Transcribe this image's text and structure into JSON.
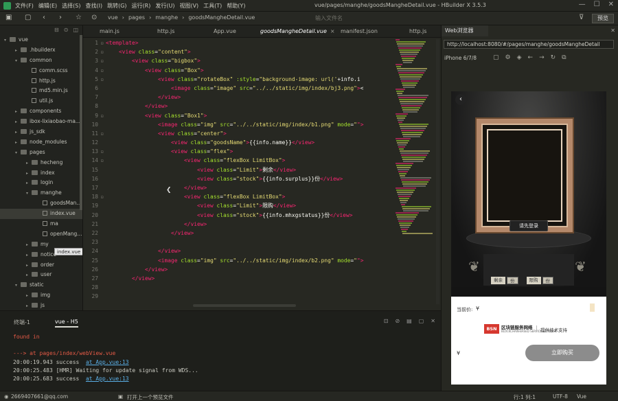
{
  "titlebar": {
    "menus": [
      "文件(F)",
      "编辑(E)",
      "选择(S)",
      "查找(I)",
      "跳转(G)",
      "运行(R)",
      "发行(U)",
      "视图(V)",
      "工具(T)",
      "帮助(Y)"
    ],
    "title": "vue/pages/manghe/goodsMangheDetail.vue - HBuilder X 3.5.3"
  },
  "toolbar": {
    "breadcrumb": [
      "vue",
      "pages",
      "manghe",
      "goodsMangheDetail.vue"
    ],
    "search_placeholder": "输入文件名",
    "run_label": "预览"
  },
  "sidebar": {
    "tree": [
      {
        "label": "vue",
        "type": "folder",
        "depth": 0,
        "open": true
      },
      {
        "label": ".hbuilderx",
        "type": "folder",
        "depth": 1,
        "open": false
      },
      {
        "label": "common",
        "type": "folder",
        "depth": 1,
        "open": true
      },
      {
        "label": "comm.scss",
        "type": "file",
        "depth": 2
      },
      {
        "label": "http.js",
        "type": "file",
        "depth": 2
      },
      {
        "label": "md5.min.js",
        "type": "file",
        "depth": 2
      },
      {
        "label": "util.js",
        "type": "file",
        "depth": 2
      },
      {
        "label": "components",
        "type": "folder",
        "depth": 1,
        "open": false
      },
      {
        "label": "ibox-lixiaobao-ma...",
        "type": "folder",
        "depth": 1,
        "open": false
      },
      {
        "label": "js_sdk",
        "type": "folder",
        "depth": 1,
        "open": false
      },
      {
        "label": "node_modules",
        "type": "folder",
        "depth": 1,
        "open": false
      },
      {
        "label": "pages",
        "type": "folder",
        "depth": 1,
        "open": true
      },
      {
        "label": "hecheng",
        "type": "folder",
        "depth": 2,
        "open": false
      },
      {
        "label": "index",
        "type": "folder",
        "depth": 2,
        "open": false
      },
      {
        "label": "login",
        "type": "folder",
        "depth": 2,
        "open": false
      },
      {
        "label": "manghe",
        "type": "folder",
        "depth": 2,
        "open": true
      },
      {
        "label": "goodsMan...",
        "type": "file",
        "depth": 3
      },
      {
        "label": "index.vue",
        "type": "file",
        "depth": 3,
        "selected": true
      },
      {
        "label": "ma",
        "type": "file",
        "depth": 3
      },
      {
        "label": "openMang...",
        "type": "file",
        "depth": 3
      },
      {
        "label": "my",
        "type": "folder",
        "depth": 2,
        "open": false
      },
      {
        "label": "notice",
        "type": "folder",
        "depth": 2,
        "open": false
      },
      {
        "label": "order",
        "type": "folder",
        "depth": 2,
        "open": false
      },
      {
        "label": "user",
        "type": "folder",
        "depth": 2,
        "open": false
      },
      {
        "label": "static",
        "type": "folder",
        "depth": 1,
        "open": true
      },
      {
        "label": "img",
        "type": "folder",
        "depth": 2,
        "open": false
      },
      {
        "label": "js",
        "type": "folder",
        "depth": 2,
        "open": false
      }
    ],
    "tooltip": "index.vue"
  },
  "editor": {
    "tabs": [
      {
        "label": "main.js",
        "active": false
      },
      {
        "label": "http.js",
        "active": false
      },
      {
        "label": "App.vue",
        "active": false
      },
      {
        "label": "goodsMangheDetail.vue",
        "active": true
      },
      {
        "label": "manifest.json",
        "active": false
      },
      {
        "label": "http.js",
        "active": false
      }
    ],
    "lines": [
      {
        "n": "1",
        "fold": "⊟",
        "indent": 0,
        "t": [
          [
            "tg",
            "<template>"
          ]
        ]
      },
      {
        "n": "2",
        "fold": "⊟",
        "indent": 1,
        "t": [
          [
            "tg",
            "<view "
          ],
          [
            "at",
            "class"
          ],
          [
            "tx",
            "="
          ],
          [
            "st",
            "\"content\""
          ],
          [
            "tg",
            ">"
          ]
        ]
      },
      {
        "n": "3",
        "fold": "⊟",
        "indent": 2,
        "t": [
          [
            "tg",
            "<view "
          ],
          [
            "at",
            "class"
          ],
          [
            "tx",
            "="
          ],
          [
            "st",
            "\"bigbox\""
          ],
          [
            "tg",
            ">"
          ]
        ]
      },
      {
        "n": "4",
        "fold": "⊟",
        "indent": 3,
        "t": [
          [
            "tg",
            "<view "
          ],
          [
            "at",
            "class"
          ],
          [
            "tx",
            "="
          ],
          [
            "st",
            "\"Box\""
          ],
          [
            "tg",
            ">"
          ]
        ]
      },
      {
        "n": "5",
        "fold": "⊟",
        "indent": 4,
        "t": [
          [
            "tg",
            "<view "
          ],
          [
            "at",
            "class"
          ],
          [
            "tx",
            "="
          ],
          [
            "st",
            "\"rotateBox\" "
          ],
          [
            "at",
            ":style"
          ],
          [
            "tx",
            "="
          ],
          [
            "st",
            "\"background-image: url('"
          ],
          [
            "tx",
            "+info.i"
          ]
        ]
      },
      {
        "n": "6",
        "fold": "",
        "indent": 5,
        "t": [
          [
            "tg",
            "<image "
          ],
          [
            "at",
            "class"
          ],
          [
            "tx",
            "="
          ],
          [
            "st",
            "\"image\" "
          ],
          [
            "at",
            "src"
          ],
          [
            "tx",
            "="
          ],
          [
            "st",
            "\"../../static/img/index/bj3.png\""
          ],
          [
            "tg",
            ">"
          ],
          [
            "tx",
            "<"
          ]
        ]
      },
      {
        "n": "7",
        "fold": "",
        "indent": 4,
        "t": [
          [
            "tg",
            "</view>"
          ]
        ]
      },
      {
        "n": "8",
        "fold": "",
        "indent": 3,
        "t": [
          [
            "tg",
            "</view>"
          ]
        ]
      },
      {
        "n": "9",
        "fold": "⊟",
        "indent": 3,
        "t": [
          [
            "tg",
            "<view "
          ],
          [
            "at",
            "class"
          ],
          [
            "tx",
            "="
          ],
          [
            "st",
            "\"Box1\""
          ],
          [
            "tg",
            ">"
          ]
        ]
      },
      {
        "n": "10",
        "fold": "",
        "indent": 4,
        "t": [
          [
            "tg",
            "<image "
          ],
          [
            "at",
            "class"
          ],
          [
            "tx",
            "="
          ],
          [
            "st",
            "\"img\" "
          ],
          [
            "at",
            "src"
          ],
          [
            "tx",
            "="
          ],
          [
            "st",
            "\"../../static/img/index/b1.png\" "
          ],
          [
            "at",
            "mode"
          ],
          [
            "tx",
            "="
          ],
          [
            "st",
            "\""
          ],
          [
            "tg",
            "\">"
          ]
        ]
      },
      {
        "n": "11",
        "fold": "⊟",
        "indent": 4,
        "t": [
          [
            "tg",
            "<view "
          ],
          [
            "at",
            "class"
          ],
          [
            "tx",
            "="
          ],
          [
            "st",
            "\"center\""
          ],
          [
            "tg",
            ">"
          ]
        ]
      },
      {
        "n": "12",
        "fold": "",
        "indent": 5,
        "t": [
          [
            "tg",
            "<view "
          ],
          [
            "at",
            "class"
          ],
          [
            "tx",
            "="
          ],
          [
            "st",
            "\"goodsName\""
          ],
          [
            "tg",
            ">"
          ],
          [
            "tx",
            "{{info.name}}"
          ],
          [
            "tg",
            "</view>"
          ]
        ]
      },
      {
        "n": "13",
        "fold": "⊟",
        "indent": 5,
        "t": [
          [
            "tg",
            "<view "
          ],
          [
            "at",
            "class"
          ],
          [
            "tx",
            "="
          ],
          [
            "st",
            "\"flex\""
          ],
          [
            "tg",
            ">"
          ]
        ]
      },
      {
        "n": "14",
        "fold": "⊟",
        "indent": 6,
        "t": [
          [
            "tg",
            "<view "
          ],
          [
            "at",
            "class"
          ],
          [
            "tx",
            "="
          ],
          [
            "st",
            "\"flexBox LimitBox\""
          ],
          [
            "tg",
            ">"
          ]
        ]
      },
      {
        "n": "15",
        "fold": "",
        "indent": 7,
        "t": [
          [
            "tg",
            "<view "
          ],
          [
            "at",
            "class"
          ],
          [
            "tx",
            "="
          ],
          [
            "st",
            "\"Limit\""
          ],
          [
            "tg",
            ">"
          ],
          [
            "tx",
            "剩余"
          ],
          [
            "tg",
            "</view>"
          ]
        ]
      },
      {
        "n": "16",
        "fold": "",
        "indent": 7,
        "t": [
          [
            "tg",
            "<view "
          ],
          [
            "at",
            "class"
          ],
          [
            "tx",
            "="
          ],
          [
            "st",
            "\"stock\""
          ],
          [
            "tg",
            ">"
          ],
          [
            "tx",
            "{{info.surplus}}份"
          ],
          [
            "tg",
            "</view>"
          ]
        ]
      },
      {
        "n": "17",
        "fold": "",
        "indent": 6,
        "t": [
          [
            "tg",
            "</view>"
          ]
        ]
      },
      {
        "n": "18",
        "fold": "⊟",
        "indent": 6,
        "t": [
          [
            "tg",
            "<view "
          ],
          [
            "at",
            "class"
          ],
          [
            "tx",
            "="
          ],
          [
            "st",
            "\"flexBox LimitBox\""
          ],
          [
            "tg",
            ">"
          ]
        ]
      },
      {
        "n": "19",
        "fold": "",
        "indent": 7,
        "t": [
          [
            "tg",
            "<view "
          ],
          [
            "at",
            "class"
          ],
          [
            "tx",
            "="
          ],
          [
            "st",
            "\"Limit\""
          ],
          [
            "tg",
            ">"
          ],
          [
            "tx",
            "限购"
          ],
          [
            "tg",
            "</view>"
          ]
        ]
      },
      {
        "n": "20",
        "fold": "",
        "indent": 7,
        "t": [
          [
            "tg",
            "<view "
          ],
          [
            "at",
            "class"
          ],
          [
            "tx",
            "="
          ],
          [
            "st",
            "\"stock\""
          ],
          [
            "tg",
            ">"
          ],
          [
            "tx",
            "{{info.mhxgstatus}}份"
          ],
          [
            "tg",
            "</view>"
          ]
        ]
      },
      {
        "n": "21",
        "fold": "",
        "indent": 6,
        "t": [
          [
            "tg",
            "</view>"
          ]
        ]
      },
      {
        "n": "22",
        "fold": "",
        "indent": 5,
        "t": [
          [
            "tg",
            "</view>"
          ]
        ]
      },
      {
        "n": "23",
        "fold": "",
        "indent": 0,
        "t": []
      },
      {
        "n": "24",
        "fold": "",
        "indent": 4,
        "t": [
          [
            "tg",
            "</view>"
          ]
        ]
      },
      {
        "n": "25",
        "fold": "",
        "indent": 4,
        "t": [
          [
            "tg",
            "<image "
          ],
          [
            "at",
            "class"
          ],
          [
            "tx",
            "="
          ],
          [
            "st",
            "\"img\" "
          ],
          [
            "at",
            "src"
          ],
          [
            "tx",
            "="
          ],
          [
            "st",
            "\"../../static/img/index/b2.png\" "
          ],
          [
            "at",
            "mode"
          ],
          [
            "tx",
            "="
          ],
          [
            "st",
            "\""
          ],
          [
            "tg",
            "\">"
          ]
        ]
      },
      {
        "n": "26",
        "fold": "",
        "indent": 3,
        "t": [
          [
            "tg",
            "</view>"
          ]
        ]
      },
      {
        "n": "27",
        "fold": "",
        "indent": 2,
        "t": [
          [
            "tg",
            "</view>"
          ]
        ]
      },
      {
        "n": "28",
        "fold": "",
        "indent": 0,
        "t": []
      },
      {
        "n": "29",
        "fold": "",
        "indent": 0,
        "t": []
      }
    ]
  },
  "browser": {
    "title": "Web浏览器",
    "url": "http://localhost:8080/#/pages/manghe/goodsMangheDetail",
    "device": "iPhone 6/7/8",
    "page": {
      "login_label": "请先登录",
      "tag_remain": "剩余",
      "tag_unit1": "份",
      "tag_limit": "限购",
      "tag_unit2": "份",
      "price_label": "当前价:",
      "price_symbol": "¥",
      "bsn_logo": "BSN",
      "bsn_name": "区块链服务网络",
      "bsn_sub": "BLOCKCHAIN-BASED SERVICE NETWORK",
      "support": "提供技术支持",
      "cart_symbol": "¥",
      "buy_label": "立即购买"
    }
  },
  "console": {
    "tabs": [
      {
        "label": "终端-1",
        "active": false
      },
      {
        "label": "vue - H5",
        "active": true
      }
    ],
    "lines": [
      [
        [
          "red",
          "found in"
        ]
      ],
      [],
      [
        [
          "red",
          "---> at pages/index/webView.vue"
        ]
      ],
      [
        [
          "gr",
          "20:00:19.943 success  "
        ],
        [
          "link",
          "at App.vue:13"
        ]
      ],
      [
        [
          "gr",
          "20:00:25.483 [HMR] Waiting for update signal from WDS..."
        ]
      ],
      [
        [
          "gr",
          "20:00:25.683 success  "
        ],
        [
          "link",
          "at App.vue:13"
        ]
      ]
    ]
  },
  "statusbar": {
    "user": "2669407661@qq.com",
    "hint": "打开上一个预览文件",
    "position": "行:1  列:1",
    "encoding": "UTF-8",
    "lang": "Vue"
  }
}
